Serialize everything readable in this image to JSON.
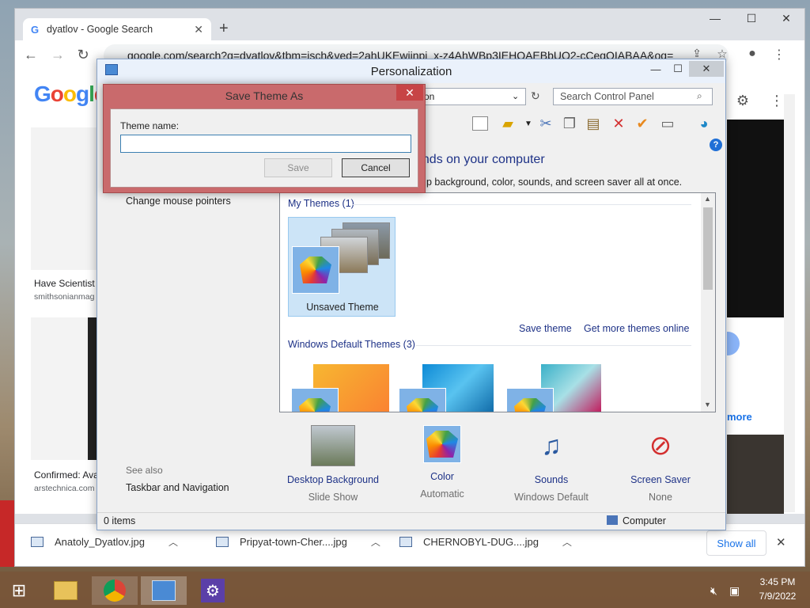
{
  "chrome": {
    "tab_title": "dyatlov - Google Search",
    "tab_icon": "G",
    "new_tab": "+",
    "url": "google.com/search?q=dyatlov&tbm=isch&ved=2ahUKEwiinpj_x-z4AhWBp3IEHQAEBbUQ2-cCegQIABAA&oq=",
    "min": "—",
    "max": "☐",
    "close": "✕",
    "logo": "Google"
  },
  "google_results": {
    "card1_title": "Have Scientist",
    "card1_source": "smithsonianmag",
    "card2_title": "Confirmed: Ava",
    "card2_source": "arstechnica.com",
    "more_text": "more"
  },
  "downloads": {
    "items": [
      "Anatoly_Dyatlov.jpg",
      "Pripyat-town-Cher....jpg",
      "CHERNOBYL-DUG....jpg"
    ],
    "show_all": "Show all",
    "close": "✕"
  },
  "personalization": {
    "title": "Personalization",
    "address_fragment": "on",
    "search_placeholder": "Search Control Panel",
    "header": "unds on your computer",
    "header_sub": "p background, color, sounds, and screen saver all at once.",
    "left_link": "Change mouse pointers",
    "see_also": "See also",
    "see_also_link": "Taskbar and Navigation",
    "my_themes_header": "My Themes (1)",
    "unsaved_theme": "Unsaved Theme",
    "save_theme": "Save theme",
    "get_more": "Get more themes online",
    "default_themes_header": "Windows Default Themes (3)",
    "bottom": [
      {
        "label": "Desktop Background",
        "sub": "Slide Show"
      },
      {
        "label": "Color",
        "sub": "Automatic"
      },
      {
        "label": "Sounds",
        "sub": "Windows Default"
      },
      {
        "label": "Screen Saver",
        "sub": "None"
      }
    ],
    "status_items": "0 items",
    "status_location": "Computer"
  },
  "dialog": {
    "title": "Save Theme As",
    "close": "✕",
    "label": "Theme name:",
    "value": "",
    "save": "Save",
    "cancel": "Cancel"
  },
  "taskbar": {
    "time": "3:45 PM",
    "date": "7/9/2022"
  },
  "colors": {
    "dialog_frame": "#c96a6c",
    "link_blue": "#1e3287",
    "taskbar": "#78563a"
  }
}
